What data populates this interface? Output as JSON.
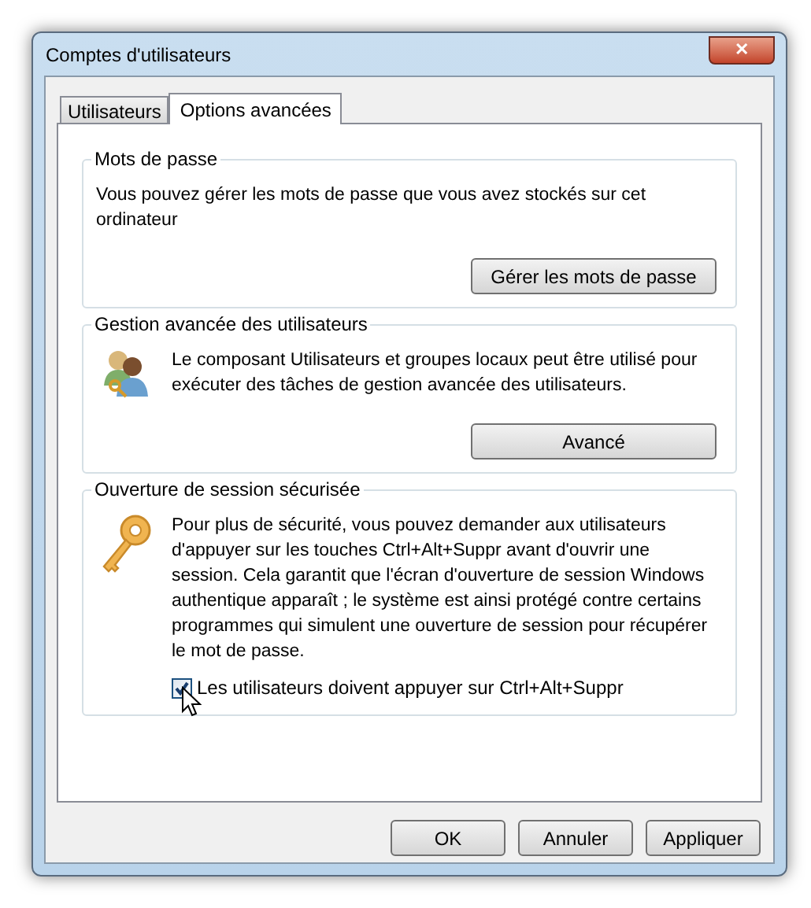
{
  "window": {
    "title": "Comptes d'utilisateurs",
    "close": "✕"
  },
  "tabs": [
    {
      "label": "Utilisateurs",
      "selected": false
    },
    {
      "label": "Options avancées",
      "selected": true
    }
  ],
  "groups": [
    {
      "title": "Mots de passe",
      "text": "Vous pouvez gérer les mots de passe que vous avez stockés sur cet ordinateur",
      "button": "Gérer les mots de passe"
    },
    {
      "title": "Gestion avancée des utilisateurs",
      "text": "Le composant Utilisateurs et groupes locaux peut être utilisé pour exécuter des tâches de gestion avancée des utilisateurs.",
      "button": "Avancé"
    },
    {
      "title": "Ouverture de session sécurisée",
      "text": "Pour plus de sécurité, vous pouvez demander aux utilisateurs d'appuyer sur les touches Ctrl+Alt+Suppr avant d'ouvrir une session. Cela garantit que l'écran d'ouverture de session Windows authentique apparaît ; le système est ainsi protégé contre certains programmes qui simulent une ouverture de session pour récupérer le mot de passe.",
      "checkbox": {
        "label": "Les utilisateurs doivent appuyer sur Ctrl+Alt+Suppr",
        "checked": true
      }
    }
  ],
  "buttons": [
    "OK",
    "Annuler",
    "Appliquer"
  ]
}
